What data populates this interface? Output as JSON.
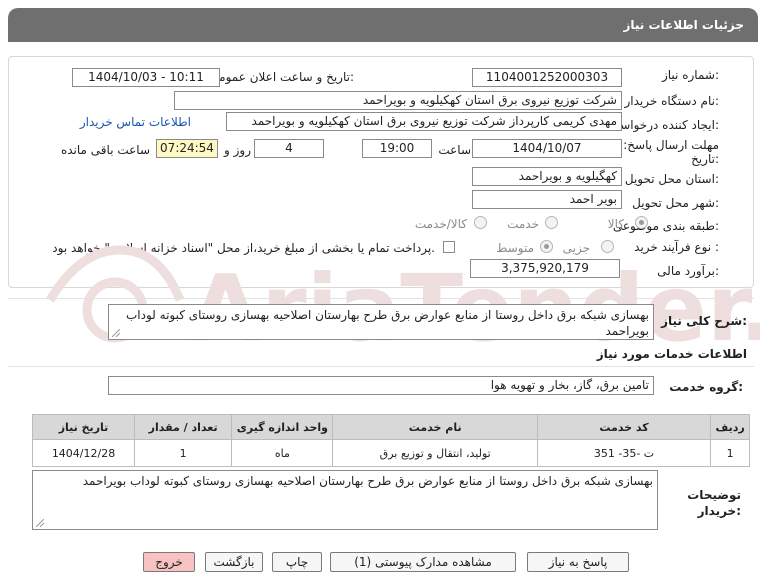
{
  "header": {
    "title": "جزئیات اطلاعات نیاز"
  },
  "fields": {
    "need_number_label": "شماره نیاز:",
    "need_number": "1104001252000303",
    "announce_label": "تاریخ و ساعت اعلان عمومی:",
    "announce_value": "1404/10/03 - 10:11",
    "buyer_label": "نام دستگاه خریدار:",
    "buyer_value": "شرکت توزیع نیروی برق استان کهکیلویه و بویراحمد",
    "requester_label": "ایجاد کننده درخواست:",
    "requester_value": "مهدی کریمی کارپرداز شرکت توزیع نیروی برق استان کهکیلویه و بویراحمد",
    "contact_link": "اطلاعات تماس خریدار",
    "deadline_label_1": "مهلت ارسال پاسخ: تا",
    "deadline_label_2": "تاریخ:",
    "deadline_date": "1404/10/07",
    "time_label": "ساعت",
    "deadline_time": "19:00",
    "days_value": "4",
    "days_label": "روز و",
    "remaining_time": "07:24:54",
    "remaining_label": "ساعت باقی مانده",
    "province_label": "استان محل تحویل:",
    "province_value": "کهگیلویه و بویراحمد",
    "city_label": "شهر محل تحویل:",
    "city_value": "بویر احمد",
    "category_label": "طبقه بندی موضوعی:",
    "category_options": [
      "کالا",
      "خدمت",
      "کالا/خدمت"
    ],
    "process_label": "نوع فرآیند خرید :",
    "process_options": [
      "جزیی",
      "متوسط"
    ],
    "payment_note": "پرداخت تمام یا بخشی از مبلغ خرید،از محل \"اسناد خزانه اسلامی\" خواهد بود.",
    "estimate_label": "برآورد مالی:",
    "estimate_value": "3,375,920,179"
  },
  "summary": {
    "label": "شرح کلی نیاز:",
    "text": "بهسازی شبکه برق داخل روستا از منابع عوارض برق طرح بهارستان اصلاحیه بهسازی روستای کبوته لوداب بویراحمد"
  },
  "services": {
    "section_title": "اطلاعات خدمات مورد نیاز",
    "group_label": "گروه خدمت:",
    "group_value": "تامین برق، گاز، بخار و تهویه هوا",
    "columns": [
      "ردیف",
      "کد خدمت",
      "نام خدمت",
      "واحد اندازه گیری",
      "تعداد / مقدار",
      "تاریخ نیاز"
    ],
    "rows": [
      [
        "1",
        "ت -35- 351",
        "تولید، انتقال و توزیع برق",
        "ماه",
        "1",
        "1404/12/28"
      ]
    ]
  },
  "notes": {
    "label_1": "توضیحات",
    "label_2": "خریدار:",
    "text": "بهسازی شبکه برق داخل روستا از منابع عوارض برق طرح بهارستان اصلاحیه بهسازی روستای کبوته لوداب بویراحمد"
  },
  "buttons": {
    "reply": "پاسخ به نیاز",
    "attachments": "مشاهده مدارک پیوستی (1)",
    "print": "چاپ",
    "back": "بازگشت",
    "exit": "خروج"
  },
  "watermark": {
    "text": "AriaTender.neT"
  },
  "colors": {
    "header_bg": "#6f6f6f",
    "link": "#1a55b3",
    "remaining_bg": "#fdf8c4",
    "exit_bg": "#f7c2c2"
  }
}
